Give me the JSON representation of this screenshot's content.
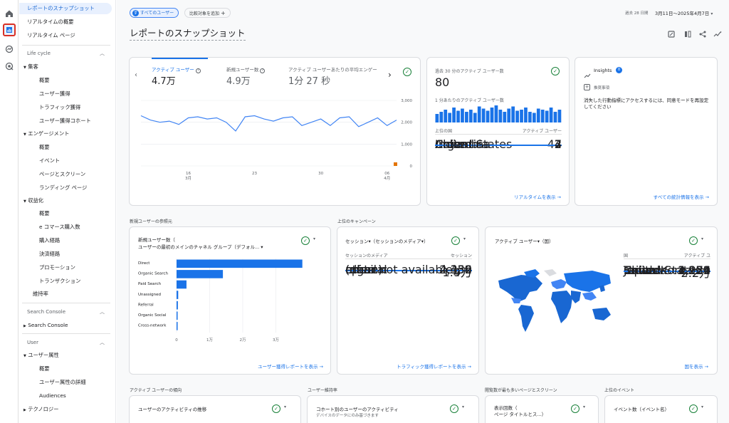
{
  "rail": {
    "icons": [
      "home-icon",
      "reports-icon",
      "explore-icon",
      "advertising-icon"
    ]
  },
  "nav": {
    "top": [
      "レポートのスナップショット",
      "リアルタイムの概要",
      "リアルタイム ページ"
    ],
    "lifecycle": "Life cycle",
    "acq": "集客",
    "acq_items": [
      "概要",
      "ユーザー獲得",
      "トラフィック獲得",
      "ユーザー獲得コホート"
    ],
    "eng": "エンゲージメント",
    "eng_items": [
      "概要",
      "イベント",
      "ページとスクリーン",
      "ランディング ページ"
    ],
    "mon": "収益化",
    "mon_items": [
      "概要",
      "e コマース購入数",
      "購入経路",
      "決済経路",
      "プロモーション",
      "トランザクション"
    ],
    "ret": "維持率",
    "sc_section": "Search Console",
    "sc": "Search Console",
    "user_section": "User",
    "ua": "ユーザー属性",
    "ua_items": [
      "概要",
      "ユーザー属性の詳細",
      "Audiences"
    ],
    "tech": "テクノロジー"
  },
  "header": {
    "all_users": "すべてのユーザー",
    "add_compare": "比較対象を追加",
    "period_label": "過去 28 日間",
    "period": "3月11日～2025年4月7日",
    "title": "レポートのスナップショット"
  },
  "metrics": {
    "active_label": "アクティブ ユーザー",
    "active_value": "4.7万",
    "new_label": "新規ユーザー数",
    "new_value": "4.9万",
    "avg_label": "アクティブ ユーザーあたりの平均エンゲー",
    "avg_value": "1分 27 秒"
  },
  "chart_data": [
    {
      "type": "line",
      "x": [
        "3/11",
        "3/12",
        "3/13",
        "3/14",
        "3/15",
        "3/16",
        "3/17",
        "3/18",
        "3/19",
        "3/20",
        "3/21",
        "3/22",
        "3/23",
        "3/24",
        "3/25",
        "3/26",
        "3/27",
        "3/28",
        "3/29",
        "3/30",
        "3/31",
        "4/1",
        "4/2",
        "4/3",
        "4/4",
        "4/5",
        "4/6",
        "4/7"
      ],
      "values": [
        2300,
        2100,
        2000,
        2050,
        1900,
        2200,
        2250,
        2150,
        2200,
        2000,
        1600,
        2250,
        2300,
        2150,
        2050,
        2200,
        2250,
        1850,
        2000,
        2150,
        1850,
        2200,
        2250,
        1800,
        2000,
        2200,
        1850,
        2100
      ],
      "ylim": [
        0,
        3000
      ],
      "yticks": [
        "3,000",
        "2,000",
        "1,000",
        "0"
      ],
      "xticks": [
        {
          "d": "16",
          "m": "3月"
        },
        {
          "d": "23",
          "m": ""
        },
        {
          "d": "30",
          "m": ""
        },
        {
          "d": "06",
          "m": "4月"
        }
      ]
    },
    {
      "type": "bar",
      "title": "新規ユーザー数（",
      "subtitle": "ユーザーの最初のメインのチャネル グループ（デフォル...",
      "categories": [
        "Direct",
        "Organic Search",
        "Paid Search",
        "Unassigned",
        "Referral",
        "Organic Social",
        "Cross-network"
      ],
      "values": [
        38000,
        14000,
        3000,
        500,
        400,
        300,
        200
      ],
      "xticks": [
        "0",
        "1万",
        "2万",
        "3万"
      ],
      "xlim": [
        0,
        40000
      ]
    },
    {
      "type": "bar",
      "title": "過去 30 分のアクティブ ユーザー数",
      "values": [
        8,
        10,
        12,
        9,
        14,
        11,
        13,
        10,
        12,
        9,
        15,
        13,
        11,
        14,
        16,
        12,
        10,
        13,
        15,
        11,
        12,
        14,
        10,
        9,
        13,
        12,
        11,
        14,
        10,
        12
      ]
    }
  ],
  "realtime": {
    "title": "過去 30 分のアクティブ ユーザー数",
    "value": "80",
    "sub": "1 分あたりのアクティブ ユーザー数",
    "col1": "上位の国",
    "col2": "アクティブ ユーザー",
    "rows": [
      {
        "n": "United States",
        "v": "42",
        "p": 1.0
      },
      {
        "n": "China",
        "v": "7",
        "p": 0.17
      },
      {
        "n": "Argentina",
        "v": "4",
        "p": 0.1
      },
      {
        "n": "Colombia",
        "v": "4",
        "p": 0.1
      },
      {
        "n": "India",
        "v": "3",
        "p": 0.07
      }
    ],
    "link": "リアルタイムを表示"
  },
  "insights": {
    "title": "Insights",
    "badge": "0",
    "rec": "推奨事項",
    "msg": "消失した行動指標にアクセスするには、同意モードを再設定してください",
    "link": "すべての統計情報を表示"
  },
  "sec_new": "新規ユーザーの参照元",
  "sec_camp": "上位のキャンペーン",
  "newusers": {
    "link": "ユーザー獲得レポートを表示"
  },
  "sessions": {
    "title": "セッション▾（セッションのメディア▾）",
    "col1": "セッションのメディア",
    "col2": "セッション",
    "rows": [
      {
        "n": "(none)",
        "v": "4万",
        "p": 1.0
      },
      {
        "n": "organic",
        "v": "1.9万",
        "p": 0.48
      },
      {
        "n": "cpc",
        "v": "4,332",
        "p": 0.11
      },
      {
        "n": "referral",
        "v": "2,439",
        "p": 0.06
      },
      {
        "n": "email",
        "v": "352",
        "p": 0.01
      },
      {
        "n": "(data not available)",
        "v": "336",
        "p": 0.01
      },
      {
        "n": "other",
        "v": "2",
        "p": 0
      }
    ],
    "link": "トラフィック獲得レポートを表示"
  },
  "country": {
    "title": "アクティブ ユーザー▾（国）",
    "col1": "国",
    "col2": "アクティブ ユ",
    "rows": [
      {
        "n": "United States",
        "v": "2.2万",
        "p": 1.0
      },
      {
        "n": "India",
        "v": "4,256",
        "p": 0.19
      },
      {
        "n": "China",
        "v": "3,274",
        "p": 0.15
      },
      {
        "n": "Canada",
        "v": "2,222",
        "p": 0.1
      },
      {
        "n": "Taiwan",
        "v": "1,289",
        "p": 0.06
      },
      {
        "n": "Japan",
        "v": "1,126",
        "p": 0.05
      },
      {
        "n": "South Korea",
        "v": "971",
        "p": 0.04
      }
    ],
    "link": "国を表示"
  },
  "bottom": {
    "s1": "アクティブ ユーザーの傾向",
    "s2": "ユーザー維持率",
    "s3": "閲覧数が最も多いページとスクリーン",
    "s4": "上位のイベント",
    "c1": "ユーザーのアクティビティの推移",
    "c2": "コホート別のユーザーのアクティビティ",
    "c2sub": "デバイスのデータにのみ基づきます",
    "c3a": "表示回数（",
    "c3b": "ページ タイトルとス...）",
    "c4": "イベント数（イベント名）"
  }
}
